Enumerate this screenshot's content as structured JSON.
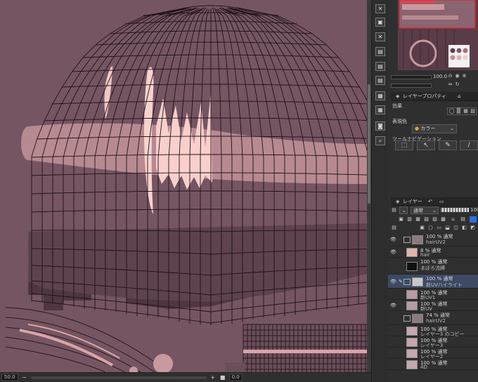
{
  "status_bar": {
    "zoom_value": "50.0",
    "angle_value": "0.0"
  },
  "navigator": {
    "zoom_value": "100.0",
    "swatch_colors": [
      "#5a4049",
      "#7a5a66",
      "#a8707a",
      "#c98a92",
      "#e8b0b0",
      "#f2d0cc"
    ]
  },
  "properties_panel": {
    "title": "レイヤープロパティ",
    "effect_label": "効果",
    "expression_color_label": "表現色",
    "expression_color_value": "カラー",
    "tool_navigation_label": "ツールナビゲーション"
  },
  "layer_panel": {
    "title": "レイヤー",
    "blend_mode": "通常",
    "opacity_value": "100",
    "layers": [
      {
        "mode": "100 % 通常",
        "name": "hairUV2",
        "visible": true,
        "folder": true,
        "thumb": "#8a7a80"
      },
      {
        "mode": "8 % 通常",
        "name": "hair",
        "visible": true,
        "folder": false,
        "thumb": "#e0b4a6"
      },
      {
        "mode": "100 % 通常",
        "name": "まぼろ流縛",
        "visible": false,
        "folder": false,
        "thumb": "#111111"
      },
      {
        "mode": "100 % 通常",
        "name": "新UVハイライト",
        "visible": true,
        "folder": true,
        "thumb": "#c8c8c8",
        "selected": true
      },
      {
        "mode": "100 % 通常",
        "name": "新UV1",
        "visible": false,
        "folder": false,
        "thumb": "#b89ca4"
      },
      {
        "mode": "100 % 通常",
        "name": "新UV",
        "visible": true,
        "folder": false,
        "thumb": "#b89ca4"
      },
      {
        "mode": "74 % 通常",
        "name": "hairUV2",
        "visible": false,
        "folder": true,
        "thumb": "#8a7a80"
      },
      {
        "mode": "100 % 通常",
        "name": "レイヤー3 のコピー",
        "visible": false,
        "folder": false,
        "thumb": "#c4a6ae"
      },
      {
        "mode": "100 % 通常",
        "name": "レイヤー3",
        "visible": false,
        "folder": false,
        "thumb": "#c4a6ae"
      },
      {
        "mode": "100 % 通常",
        "name": "レイヤー2",
        "visible": false,
        "folder": false,
        "thumb": "#c4a6ae"
      },
      {
        "mode": "100 % 通常",
        "name": "4D",
        "visible": false,
        "folder": false,
        "thumb": "#c4a6ae"
      }
    ]
  },
  "icons": {
    "tool_strip": [
      "close-icon",
      "navigator-icon",
      "close-icon",
      "image-icon",
      "image-icon",
      "image-icon",
      "sub-view-icon",
      "sub-view-icon",
      "layer-icon",
      "image-icon",
      "camera-icon",
      "layer-search-icon"
    ],
    "nav_tools": [
      "select-tool-icon",
      "move-tool-icon",
      "pen-tool-icon",
      "brush-tool-icon"
    ]
  },
  "colors": {
    "canvas_bg": "#755562",
    "panel_bg": "#2f2f2f",
    "selection": "#3c4a63"
  }
}
